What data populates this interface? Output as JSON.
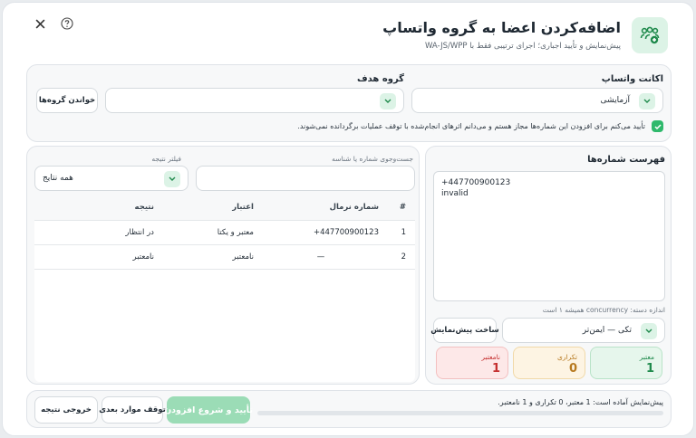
{
  "header": {
    "title": "اضافه‌کردن اعضا به گروه واتساپ",
    "subtitle": "پیش‌نمایش و تأیید اجباری؛ اجرای ترتیبی فقط با WA-JS/WPP"
  },
  "top_buttons": {
    "close_icon": "close-icon",
    "help_icon": "help-icon"
  },
  "settings": {
    "account_label": "اکانت واتساپ",
    "account_value": "آزمایشی",
    "group_label": "گروه هدف",
    "group_value": "",
    "read_groups_button": "خواندن گروه‌ها",
    "confirm_text": "تأیید می‌کنم برای افزودن این شماره‌ها مجاز هستم و می‌دانم اثرهای انجام‌شده با توقف عملیات برگردانده نمی‌شوند.",
    "confirm_checked": true
  },
  "numbers": {
    "label": "فهرست شماره‌ها",
    "text": "+447700900123\ninvalid",
    "concurrency_note": "اندازه دسته: concurrency همیشه ۱ است",
    "mode_value": "تکی — ایمن‌تر",
    "build_preview_button": "ساخت پیش‌نمایش",
    "stats": [
      {
        "label": "معتبر",
        "value": "1",
        "color": "#1f8a4c"
      },
      {
        "label": "تکراری",
        "value": "0",
        "color": "#b7791f"
      },
      {
        "label": "نامعتبر",
        "value": "1",
        "color": "#c53030"
      }
    ]
  },
  "results": {
    "search_label": "جست‌وجوی شماره یا شناسه",
    "search_value": "",
    "filter_label": "فیلتر نتیجه",
    "filter_value": "همه نتایج",
    "columns": [
      "#",
      "شماره نرمال",
      "اعتبار",
      "نتیجه"
    ],
    "rows": [
      {
        "index": "1",
        "number": "+447700900123",
        "validity": "معتبر و یکتا",
        "result": "در انتظار"
      },
      {
        "index": "2",
        "number": "—",
        "validity": "نامعتبر",
        "result": "نامعتبر"
      }
    ]
  },
  "footer": {
    "status": "پیش‌نمایش آماده است: 1 معتبر، 0 تکراری و 1 نامعتبر.",
    "progress": 0,
    "start_button": "تأیید و شروع افزودن",
    "stop_button": "توقف موارد بعدی",
    "export_button": "خروجی نتیجه"
  },
  "colors": {
    "accent": "#2fb96c",
    "accent_light": "#dcf3e6",
    "valid_bg": "#e6f6ec",
    "dup_bg": "#fdf4e3",
    "invalid_bg": "#fde8e8"
  }
}
